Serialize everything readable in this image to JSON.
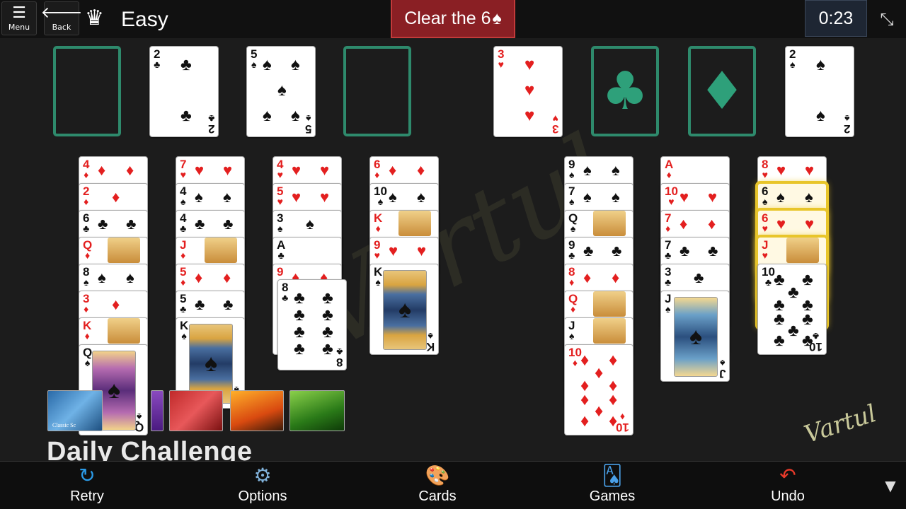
{
  "topbar": {
    "menu_label": "Menu",
    "back_label": "Back",
    "difficulty": "Easy",
    "goal_text": "Clear the 6",
    "goal_suit": "♠",
    "timer": "0:23"
  },
  "icons": {
    "menu": "hamburger-icon",
    "back": "arrow-left-icon",
    "crown": "crown-icon",
    "fullscreen": "exit-fullscreen-icon",
    "retry": "retry-icon",
    "options": "gear-icon",
    "cards": "palette-icon",
    "games": "cards-icon",
    "undo": "undo-icon",
    "more": "chevron-down-icon"
  },
  "colors": {
    "red_suit": "#e31f1f",
    "black_suit": "#111111",
    "slot_border": "#2e8a6c",
    "goal_bg": "#8a1f24",
    "highlight": "#e8c52a"
  },
  "freecells": [
    {
      "rank": "",
      "suit": ""
    },
    {
      "rank": "2",
      "suit": "♣"
    },
    {
      "rank": "5",
      "suit": "♠"
    },
    {
      "rank": "",
      "suit": ""
    }
  ],
  "foundations": [
    {
      "rank": "3",
      "suit": "♥"
    },
    {
      "rank": "",
      "suit": "♣"
    },
    {
      "rank": "",
      "suit": "♦"
    },
    {
      "rank": "2",
      "suit": "♠"
    }
  ],
  "tableau": [
    [
      {
        "rank": "4",
        "suit": "♦"
      },
      {
        "rank": "2",
        "suit": "♦"
      },
      {
        "rank": "6",
        "suit": "♣"
      },
      {
        "rank": "Q",
        "suit": "♦"
      },
      {
        "rank": "8",
        "suit": "♠"
      },
      {
        "rank": "3",
        "suit": "♦"
      },
      {
        "rank": "K",
        "suit": "♦"
      },
      {
        "rank": "Q",
        "suit": "♠"
      }
    ],
    [
      {
        "rank": "7",
        "suit": "♥"
      },
      {
        "rank": "4",
        "suit": "♠"
      },
      {
        "rank": "4",
        "suit": "♣"
      },
      {
        "rank": "J",
        "suit": "♦"
      },
      {
        "rank": "5",
        "suit": "♦"
      },
      {
        "rank": "5",
        "suit": "♣"
      },
      {
        "rank": "K",
        "suit": "♠"
      }
    ],
    [
      {
        "rank": "4",
        "suit": "♥"
      },
      {
        "rank": "5",
        "suit": "♥"
      },
      {
        "rank": "3",
        "suit": "♠"
      },
      {
        "rank": "A",
        "suit": "♣"
      },
      {
        "rank": "9",
        "suit": "♦"
      },
      {
        "rank": "8",
        "suit": "♣"
      }
    ],
    [
      {
        "rank": "6",
        "suit": "♦"
      },
      {
        "rank": "10",
        "suit": "♠"
      },
      {
        "rank": "K",
        "suit": "♦"
      },
      {
        "rank": "9",
        "suit": "♥"
      },
      {
        "rank": "K",
        "suit": "♠"
      }
    ],
    [],
    [
      {
        "rank": "9",
        "suit": "♠"
      },
      {
        "rank": "7",
        "suit": "♠"
      },
      {
        "rank": "Q",
        "suit": "♠"
      },
      {
        "rank": "9",
        "suit": "♣"
      },
      {
        "rank": "8",
        "suit": "♦"
      },
      {
        "rank": "Q",
        "suit": "♦"
      },
      {
        "rank": "J",
        "suit": "♠"
      },
      {
        "rank": "10",
        "suit": "♦"
      }
    ],
    [
      {
        "rank": "A",
        "suit": "♦"
      },
      {
        "rank": "10",
        "suit": "♥"
      },
      {
        "rank": "7",
        "suit": "♦"
      },
      {
        "rank": "7",
        "suit": "♣"
      },
      {
        "rank": "3",
        "suit": "♣"
      },
      {
        "rank": "J",
        "suit": "♠"
      }
    ],
    [
      {
        "rank": "8",
        "suit": "♥"
      },
      {
        "rank": "6",
        "suit": "♠"
      },
      {
        "rank": "6",
        "suit": "♥"
      },
      {
        "rank": "J",
        "suit": "♥"
      },
      {
        "rank": "10",
        "suit": "♣"
      }
    ]
  ],
  "highlighted_cards": [
    "6♠",
    "6♥",
    "J♥"
  ],
  "overlay": {
    "daily_challenge": "Daily Challenge",
    "theme_thumb_label": "Classic Sc"
  },
  "bottombar": {
    "retry": "Retry",
    "options": "Options",
    "cards": "Cards",
    "games": "Games",
    "undo": "Undo"
  }
}
